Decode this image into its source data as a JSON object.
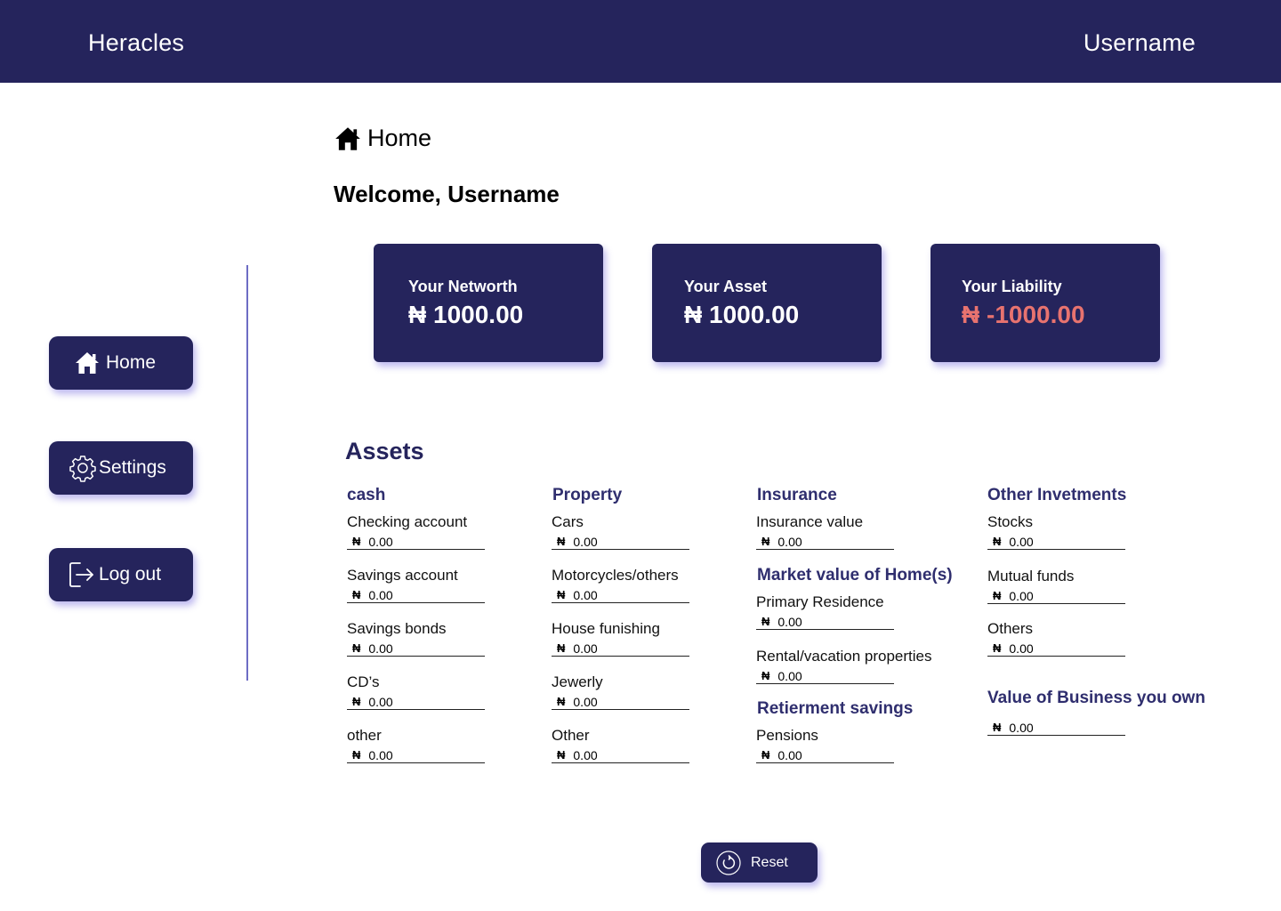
{
  "header": {
    "brand": "Heracles",
    "username": "Username"
  },
  "sidebar": {
    "items": [
      {
        "label": "Home",
        "icon": "home-icon"
      },
      {
        "label": "Settings",
        "icon": "gear-icon"
      },
      {
        "label": "Log out",
        "icon": "logout-icon"
      }
    ]
  },
  "page": {
    "title": "Home",
    "welcome": "Welcome, Username"
  },
  "summary": {
    "networth": {
      "label": "Your Networth",
      "value": "₦ 1000.00"
    },
    "asset": {
      "label": "Your Asset",
      "value": "₦ 1000.00"
    },
    "liability": {
      "label": "Your Liability",
      "value": "₦ -1000.00"
    }
  },
  "colors": {
    "primary": "#25245c",
    "accent": "#6d6cc4",
    "negative": "#e8736f"
  },
  "currency_symbol": "₦",
  "assets": {
    "heading": "Assets",
    "cash": {
      "title": "cash",
      "fields": [
        {
          "label": "Checking account",
          "value": "0.00"
        },
        {
          "label": "Savings account",
          "value": "0.00"
        },
        {
          "label": "Savings bonds",
          "value": "0.00"
        },
        {
          "label": "CD’s",
          "value": "0.00"
        },
        {
          "label": "other",
          "value": "0.00"
        }
      ]
    },
    "property": {
      "title": "Property",
      "fields": [
        {
          "label": "Cars",
          "value": "0.00"
        },
        {
          "label": "Motorcycles/others",
          "value": "0.00"
        },
        {
          "label": "House funishing",
          "value": "0.00"
        },
        {
          "label": "Jewerly",
          "value": "0.00"
        },
        {
          "label": "Other",
          "value": "0.00"
        }
      ]
    },
    "insurance": {
      "title": "Insurance",
      "fields": [
        {
          "label": "Insurance value",
          "value": "0.00"
        }
      ]
    },
    "home_value": {
      "title": "Market value of Home(s)",
      "fields": [
        {
          "label": "Primary Residence",
          "value": "0.00"
        },
        {
          "label": "Rental/vacation properties",
          "value": "0.00"
        }
      ]
    },
    "retirement": {
      "title": "Retierment savings",
      "fields": [
        {
          "label": "Pensions",
          "value": "0.00"
        }
      ]
    },
    "other_investments": {
      "title": "Other Invetments",
      "fields": [
        {
          "label": "Stocks",
          "value": "0.00"
        },
        {
          "label": "Mutual funds",
          "value": "0.00"
        },
        {
          "label": "Others",
          "value": "0.00"
        }
      ]
    },
    "business": {
      "title": "Value of Business you own",
      "value": "0.00"
    }
  },
  "reset": {
    "label": "Reset",
    "icon": "reset-icon"
  }
}
